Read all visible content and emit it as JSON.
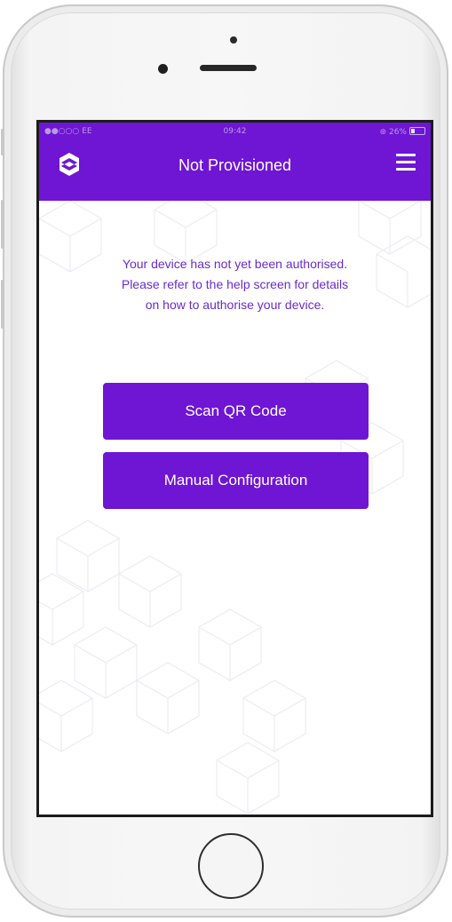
{
  "status_bar": {
    "carrier": "●●○○○ EE",
    "time": "09:42",
    "battery": "26%"
  },
  "navbar": {
    "title": "Not Provisioned",
    "logo_icon": "stack-logo-icon",
    "menu_icon": "hamburger-menu-icon"
  },
  "message": {
    "lines": [
      "Your device has not yet been authorised.",
      "Please refer to the help screen for details",
      "on how to authorise your device."
    ]
  },
  "actions": {
    "scan_label": "Scan QR Code",
    "manual_label": "Manual Configuration"
  },
  "colors": {
    "brand_purple": "#6e16d3",
    "text_purple": "#6a2bd0",
    "background": "#ffffff"
  }
}
